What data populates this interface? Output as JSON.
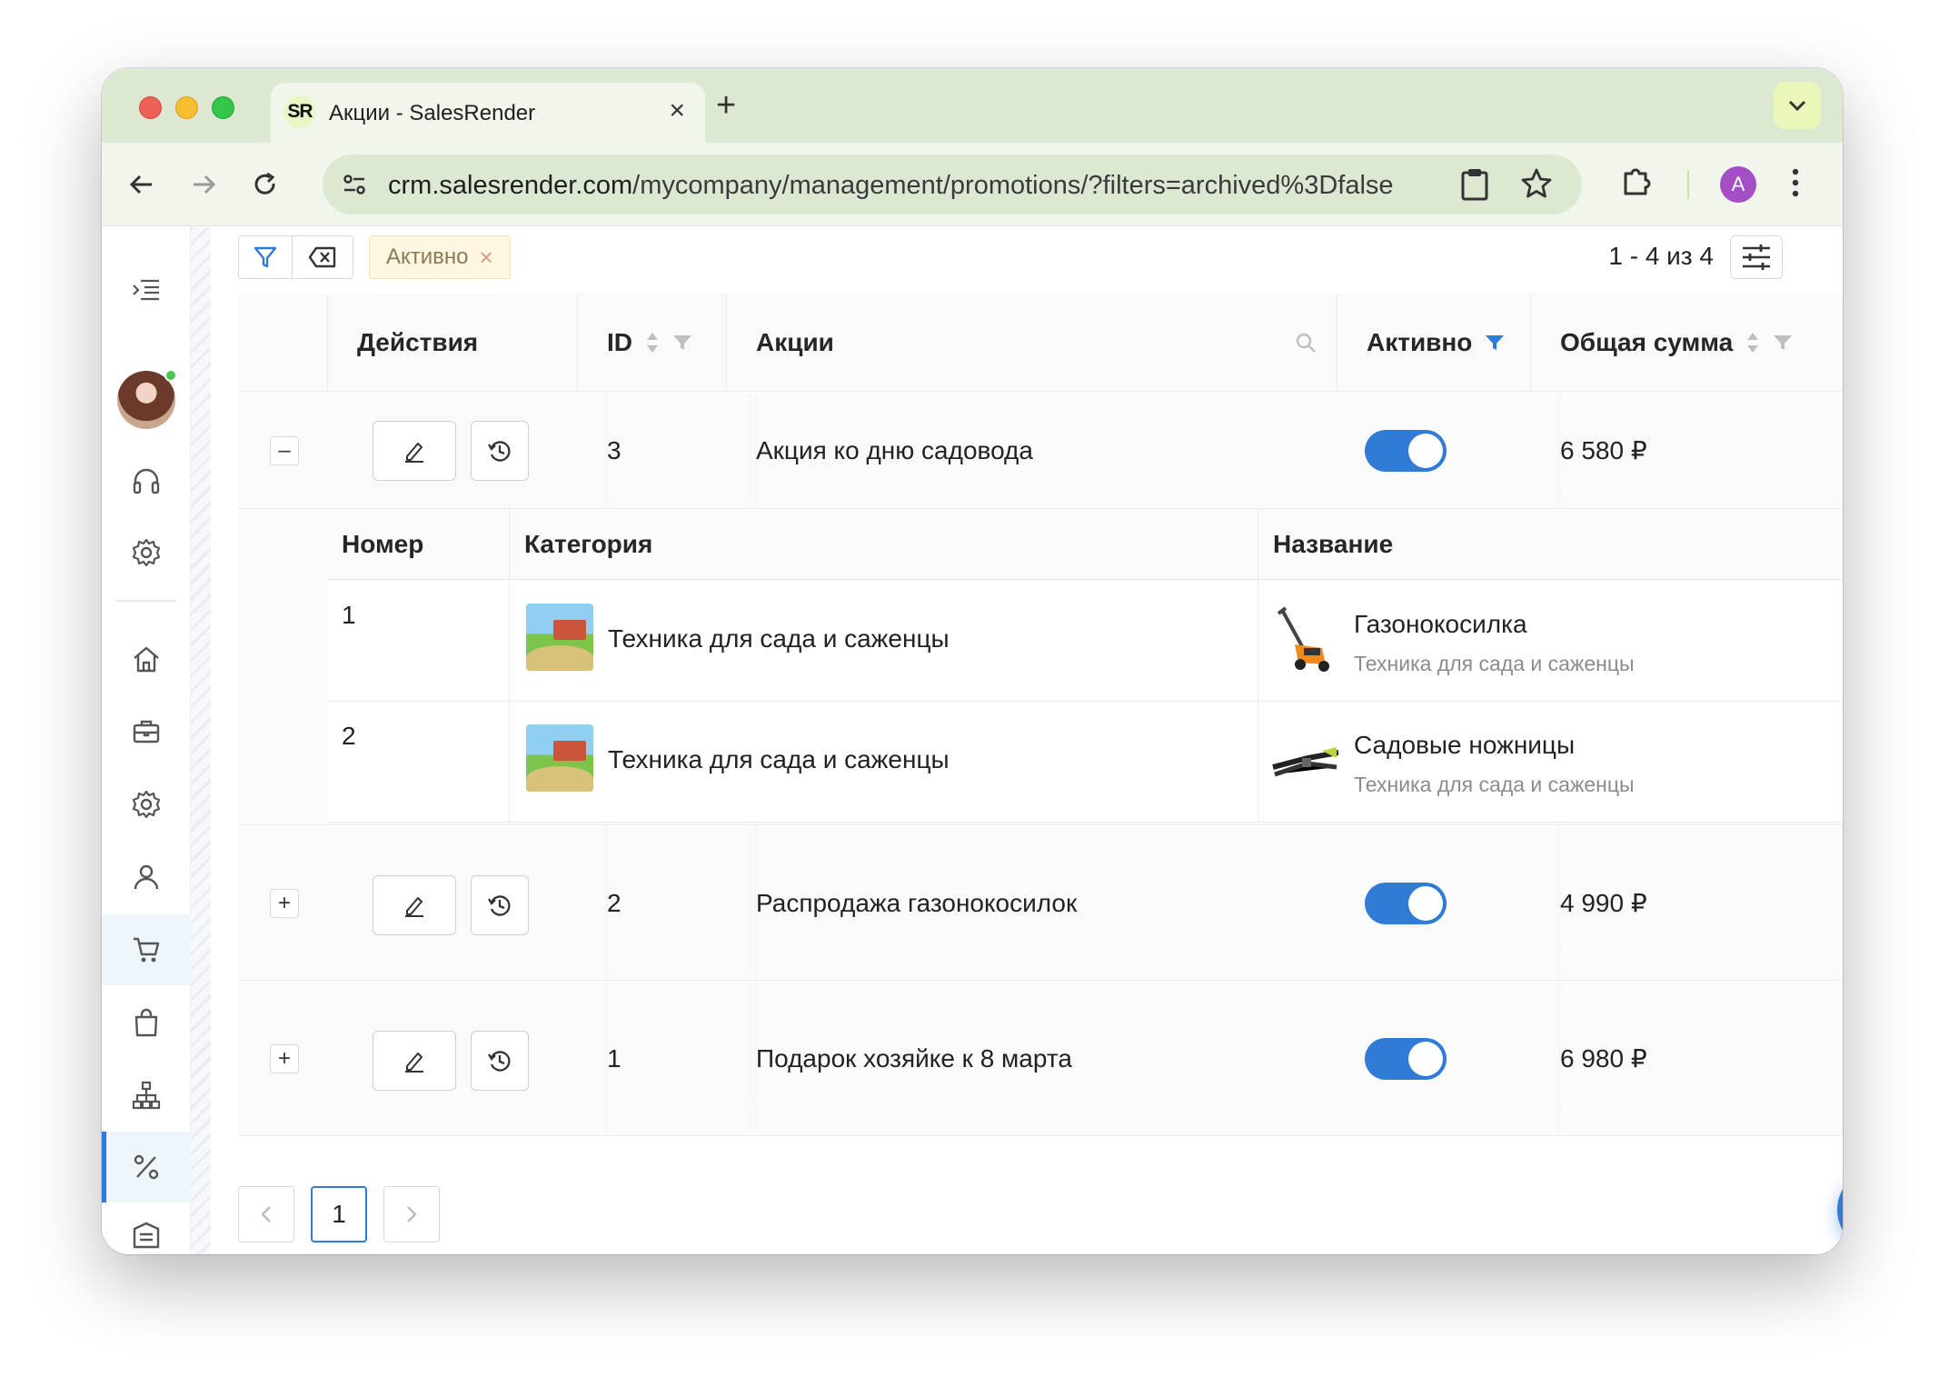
{
  "browser": {
    "tab_title": "Акции - SalesRender",
    "favicon_text": "SR",
    "url_host": "crm.salesrender.com",
    "url_path": "/mycompany/management/promotions/?filters=archived%3Dfalse",
    "profile_initial": "A"
  },
  "filters": {
    "active_chip": "Активно",
    "counter": "1 - 4 из 4"
  },
  "table": {
    "headers": {
      "actions": "Действия",
      "id": "ID",
      "promo": "Акции",
      "active": "Активно",
      "total": "Общая сумма"
    },
    "rows": [
      {
        "id": "3",
        "name": "Акция ко дню садовода",
        "active": true,
        "total": "6 580 ₽",
        "expanded": true,
        "expander": "–"
      },
      {
        "id": "2",
        "name": "Распродажа газонокосилок",
        "active": true,
        "total": "4 990 ₽",
        "expanded": false,
        "expander": "+"
      },
      {
        "id": "1",
        "name": "Подарок хозяйке к 8 марта",
        "active": true,
        "total": "6 980 ₽",
        "expanded": false,
        "expander": "+"
      }
    ]
  },
  "nested": {
    "headers": {
      "number": "Номер",
      "category": "Категория",
      "name": "Название"
    },
    "rows": [
      {
        "number": "1",
        "category": "Техника для сада и саженцы",
        "name": "Газонокосилка",
        "subtitle": "Техника для сада и саженцы"
      },
      {
        "number": "2",
        "category": "Техника для сада и саженцы",
        "name": "Садовые ножницы",
        "subtitle": "Техника для сада и саженцы"
      }
    ]
  },
  "pagination": {
    "current": "1"
  },
  "colors": {
    "accent": "#2f7bd6",
    "tabbar": "#dde8d3",
    "toolbar": "#f1f6ec"
  },
  "icons": [
    "menu-icon",
    "headset-icon",
    "gear-icon",
    "home-icon",
    "briefcase-icon",
    "user-icon",
    "cart-icon",
    "bag-icon",
    "hierarchy-icon",
    "percent-icon",
    "building-icon",
    "filter-icon",
    "clear-filter-icon",
    "column-settings-icon",
    "search-icon",
    "edit-icon",
    "history-icon",
    "plus-icon"
  ]
}
